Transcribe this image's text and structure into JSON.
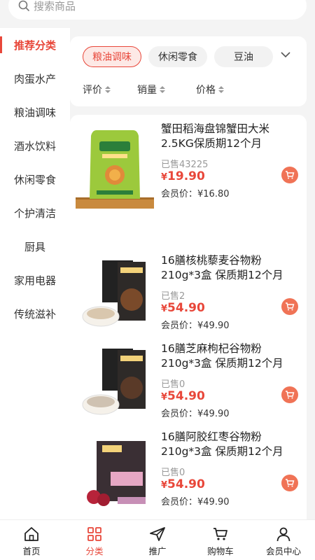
{
  "search": {
    "placeholder": "搜索商品"
  },
  "sidebar": {
    "items": [
      {
        "label": "推荐分类",
        "active": true
      },
      {
        "label": "肉蛋水产"
      },
      {
        "label": "粮油调味"
      },
      {
        "label": "酒水饮料"
      },
      {
        "label": "休闲零食"
      },
      {
        "label": "个护清洁"
      },
      {
        "label": "厨具"
      },
      {
        "label": "家用电器"
      },
      {
        "label": "传统滋补"
      }
    ]
  },
  "filters": {
    "chips": [
      {
        "label": "粮油调味",
        "active": true
      },
      {
        "label": "休闲零食"
      },
      {
        "label": "豆油"
      }
    ],
    "sort": [
      {
        "label": "评价"
      },
      {
        "label": "销量"
      },
      {
        "label": "价格"
      }
    ]
  },
  "products": [
    {
      "name": "蟹田稻海盘锦蟹田大米2.5KG保质期12个月",
      "sold": "已售43225",
      "currency": "¥",
      "price": "19.90",
      "member": "会员价：¥16.80"
    },
    {
      "name": "16膳核桃藜麦谷物粉210g*3盒 保质期12个月",
      "sold": "已售2",
      "currency": "¥",
      "price": "54.90",
      "member": "会员价：¥49.90"
    },
    {
      "name": "16膳芝麻枸杞谷物粉210g*3盒 保质期12个月",
      "sold": "已售0",
      "currency": "¥",
      "price": "54.90",
      "member": "会员价：¥49.90"
    },
    {
      "name": "16膳阿胶红枣谷物粉210g*3盒 保质期12个月",
      "sold": "已售0",
      "currency": "¥",
      "price": "54.90",
      "member": "会员价：¥49.90"
    }
  ],
  "tabs": [
    {
      "label": "首页",
      "icon": "home-icon"
    },
    {
      "label": "分类",
      "icon": "category-icon",
      "active": true
    },
    {
      "label": "推广",
      "icon": "send-icon"
    },
    {
      "label": "购物车",
      "icon": "cart-icon"
    },
    {
      "label": "会员中心",
      "icon": "user-icon"
    }
  ],
  "colors": {
    "accent": "#e8473a",
    "cart_button": "#f07356"
  }
}
